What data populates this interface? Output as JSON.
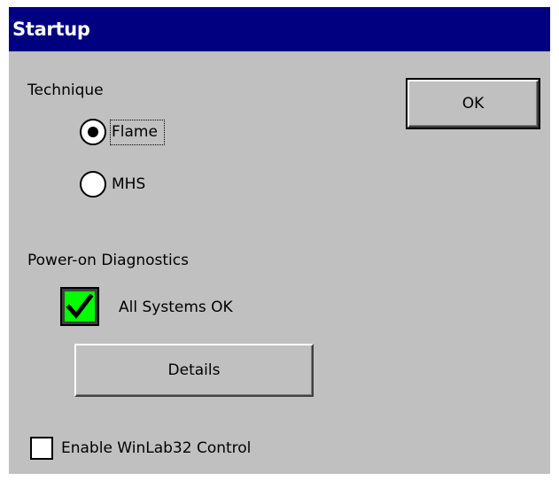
{
  "window": {
    "title": "Startup"
  },
  "technique": {
    "label": "Technique",
    "options": [
      {
        "label": "Flame",
        "selected": true
      },
      {
        "label": "MHS",
        "selected": false
      }
    ]
  },
  "buttons": {
    "ok_label": "OK",
    "details_label": "Details"
  },
  "diagnostics": {
    "label": "Power-on Diagnostics",
    "status_text": "All Systems OK",
    "status_color": "#00ff00",
    "status_icon": "check-icon"
  },
  "control": {
    "enable_label": "Enable WinLab32 Control",
    "checked": false
  },
  "colors": {
    "titlebar": "#000080",
    "dialog_bg": "#c0c0c0"
  }
}
